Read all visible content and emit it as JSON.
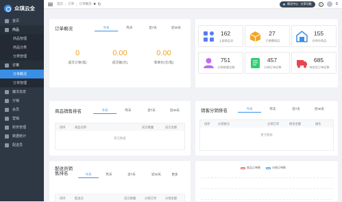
{
  "app": {
    "name": "众琪云全"
  },
  "sidebar": {
    "items": [
      {
        "label": "首页"
      },
      {
        "label": "商品"
      },
      {
        "label": "商品管理"
      },
      {
        "label": "商品分类"
      },
      {
        "label": "分类管理"
      },
      {
        "label": "订单"
      },
      {
        "label": "订单概况"
      },
      {
        "label": "订单管理"
      },
      {
        "label": "魔法去皮"
      },
      {
        "label": "分销"
      },
      {
        "label": "会员"
      },
      {
        "label": "营销"
      },
      {
        "label": "财务管理"
      },
      {
        "label": "数据统计"
      },
      {
        "label": "配送员"
      }
    ]
  },
  "header": {
    "breadcrumbs": [
      "首页",
      "订单",
      "订单概况"
    ],
    "pill_label": "概况中心 · 分享功能",
    "help_icon": "?",
    "user_initial": "S"
  },
  "order_overview": {
    "title": "订单概况",
    "tabs": [
      "今天",
      "昨天",
      "近7天",
      "近30天"
    ],
    "active_tab": 0,
    "kpis": [
      {
        "value": "0",
        "label": "成交订单(笔)"
      },
      {
        "value": "0.00",
        "label": "成交额(元)"
      },
      {
        "value": "0.00",
        "label": "客单价(元/笔)"
      }
    ]
  },
  "stats_tiles": [
    {
      "value": "162",
      "label": "上架商品总",
      "icon": "apps-icon",
      "color": "#5b7bf0"
    },
    {
      "value": "27",
      "label": "已售罄商品",
      "icon": "box-icon",
      "color": "#f5a623"
    },
    {
      "value": "155",
      "label": "仓库存商品",
      "icon": "warehouse-icon",
      "color": "#3a8ee6"
    },
    {
      "value": "751",
      "label": "分销商客总数",
      "icon": "user-icon",
      "color": "#c06cf0"
    },
    {
      "value": "457",
      "label": "分销订单总数",
      "icon": "order-icon",
      "color": "#2ecc71"
    },
    {
      "value": "685",
      "label": "待发货订单总数",
      "icon": "truck-icon",
      "color": "#e8454f"
    }
  ],
  "product_rank": {
    "title": "商品销售排名",
    "tabs": [
      "今天",
      "昨天",
      "近7天",
      "近30天"
    ],
    "active_tab": 0,
    "columns": [
      "排序",
      "商品名称",
      "成交数量",
      "成交金额"
    ],
    "empty_text": "暂无数据"
  },
  "distributor_rank": {
    "title": "销客分销排名",
    "tabs": [
      "今天",
      "昨天",
      "近7天",
      "近30天"
    ],
    "active_tab": 0,
    "columns": [
      "排序",
      "分销账号",
      "分销订单",
      "佣金金额",
      "操作"
    ],
    "empty_text": "暂无数据"
  },
  "courier_rank": {
    "title": "配送员销售排名",
    "tabs": [
      "今天",
      "昨天",
      "近7天",
      "近30天",
      "更多"
    ],
    "active_tab": 0,
    "columns": [
      "排序",
      "配送员",
      "成交数量",
      "分销订单",
      "分销金额"
    ]
  },
  "trend_chart": {
    "legend": [
      {
        "name": "商品订单数",
        "color": "#e8454f"
      },
      {
        "name": "分销订单数",
        "color": "#3a8ee6"
      }
    ]
  }
}
